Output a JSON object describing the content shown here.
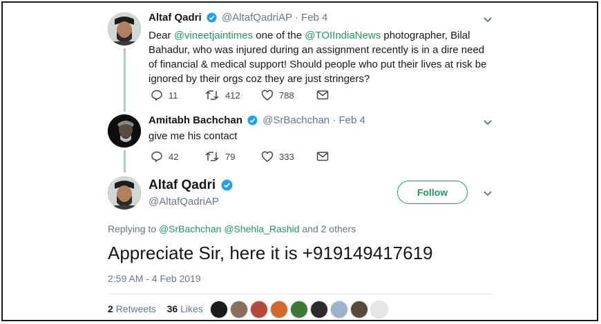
{
  "tweet1": {
    "name": "Altaf Qadri",
    "handle": "@AltafQadriAP",
    "date": "· Feb 4",
    "text_1": "Dear ",
    "mention_1": "@vineetjaintimes",
    "text_2": " one of the ",
    "mention_2": "@TOIIndiaNews",
    "text_3": " photographer, Bilal Bahadur, who was injured during an assignment recently is in a dire need of financial & medical support! Should people who put their lives at risk be ignored by their orgs coz they are just stringers?",
    "replies": "11",
    "retweets": "412",
    "likes": "788"
  },
  "tweet2": {
    "name": "Amitabh Bachchan",
    "handle": "@SrBachchan",
    "date": "· Feb 4",
    "text": "give me his contact",
    "replies": "42",
    "retweets": "79",
    "likes": "333"
  },
  "main_tweet": {
    "name": "Altaf Qadri",
    "handle": "@AltafQadriAP",
    "follow_label": "Follow",
    "replying_prefix": "Replying to ",
    "replying_mention_1": "@SrBachchan",
    "replying_mention_2": "@Shehla_Rashid",
    "replying_suffix": " and 2 others",
    "text": "Appreciate Sir, here it is +919149417619",
    "timestamp": "2:59 AM - 4 Feb 2019",
    "retweets_count": "2",
    "retweets_label": "Retweets",
    "likes_count": "36",
    "likes_label": "Likes",
    "liker_colors": [
      "#1b1b1b",
      "#8a6d5a",
      "#b44b3a",
      "#d06b2c",
      "#3c7a3a",
      "#2a2a2a",
      "#9cb3c9",
      "#5a4a3a",
      "#e6e6e6"
    ]
  },
  "colors": {
    "accent": "#1d9a5e",
    "thread_line": "#a5d6b4",
    "verified": "#1da1f2",
    "meta": "#657786"
  }
}
